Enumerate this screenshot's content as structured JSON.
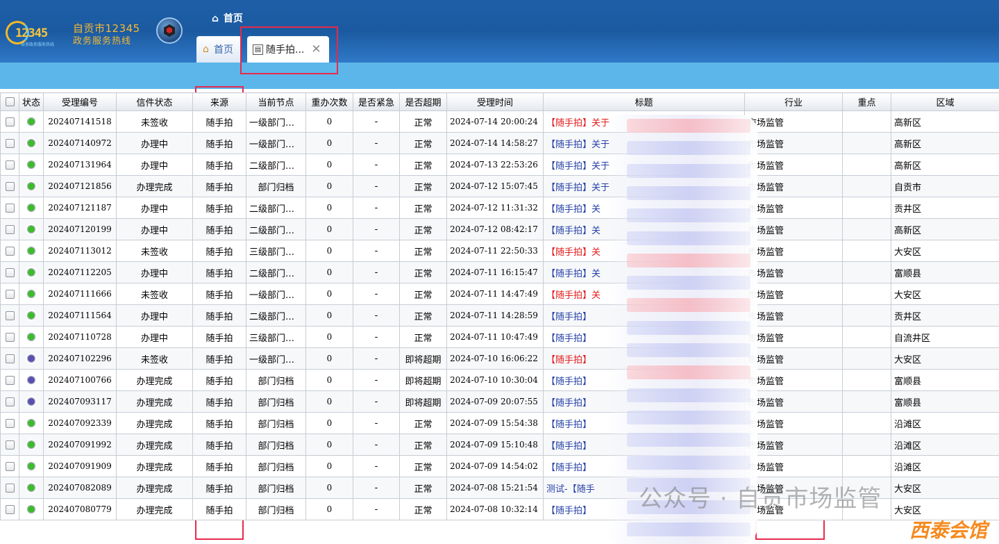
{
  "header": {
    "logo_text": "12345",
    "logo_subtext": "自贡政务服务热线",
    "brand_line1": "自贡市12345",
    "brand_line2": "政务服务热线",
    "breadcrumb": "首页"
  },
  "tabs": [
    {
      "label": "首页"
    },
    {
      "label": "随手拍..."
    }
  ],
  "columns": [
    "状态",
    "受理编号",
    "信件状态",
    "来源",
    "当前节点",
    "重办次数",
    "是否紧急",
    "是否超期",
    "受理时间",
    "标题",
    "行业",
    "重点",
    "区域"
  ],
  "rows": [
    {
      "status": "green",
      "id": "202407141518",
      "state": "未签收",
      "source": "随手拍",
      "node": "一级部门受理",
      "redo": "0",
      "urgent": "-",
      "overdue": "正常",
      "time": "2024-07-14 20:00:24",
      "title": "【随手拍】关于",
      "title_color": "red",
      "industry": "市场监管",
      "key": "",
      "area": "高新区"
    },
    {
      "status": "green",
      "id": "202407140972",
      "state": "办理中",
      "source": "随手拍",
      "node": "一级部门受理",
      "redo": "0",
      "urgent": "-",
      "overdue": "正常",
      "time": "2024-07-14 14:58:27",
      "title": "【随手拍】关于",
      "title_color": "blue",
      "industry": "市场监管",
      "key": "",
      "area": "高新区"
    },
    {
      "status": "green",
      "id": "202407131964",
      "state": "办理中",
      "source": "随手拍",
      "node": "二级部门办理",
      "redo": "0",
      "urgent": "-",
      "overdue": "正常",
      "time": "2024-07-13 22:53:26",
      "title": "【随手拍】关于",
      "title_color": "blue",
      "industry": "市场监管",
      "key": "",
      "area": "高新区"
    },
    {
      "status": "green",
      "id": "202407121856",
      "state": "办理完成",
      "source": "随手拍",
      "node": "部门归档",
      "redo": "0",
      "urgent": "-",
      "overdue": "正常",
      "time": "2024-07-12 15:07:45",
      "title": "【随手拍】关于",
      "title_color": "blue",
      "industry": "市场监管",
      "key": "",
      "area": "自贡市"
    },
    {
      "status": "green",
      "id": "202407121187",
      "state": "办理中",
      "source": "随手拍",
      "node": "二级部门办理",
      "redo": "0",
      "urgent": "-",
      "overdue": "正常",
      "time": "2024-07-12 11:31:32",
      "title": "【随手拍】关",
      "title_color": "blue",
      "industry": "市场监管",
      "key": "",
      "area": "贡井区"
    },
    {
      "status": "green",
      "id": "202407120199",
      "state": "办理中",
      "source": "随手拍",
      "node": "二级部门办理",
      "redo": "0",
      "urgent": "-",
      "overdue": "正常",
      "time": "2024-07-12 08:42:17",
      "title": "【随手拍】关",
      "title_color": "blue",
      "industry": "市场监管",
      "key": "",
      "area": "高新区"
    },
    {
      "status": "green",
      "id": "202407113012",
      "state": "未签收",
      "source": "随手拍",
      "node": "三级部门办理",
      "redo": "0",
      "urgent": "-",
      "overdue": "正常",
      "time": "2024-07-11 22:50:33",
      "title": "【随手拍】关",
      "title_color": "red",
      "industry": "市场监管",
      "key": "",
      "area": "大安区"
    },
    {
      "status": "green",
      "id": "202407112205",
      "state": "办理中",
      "source": "随手拍",
      "node": "二级部门办理",
      "redo": "0",
      "urgent": "-",
      "overdue": "正常",
      "time": "2024-07-11 16:15:47",
      "title": "【随手拍】关",
      "title_color": "blue",
      "industry": "市场监管",
      "key": "",
      "area": "富顺县"
    },
    {
      "status": "green",
      "id": "202407111666",
      "state": "未签收",
      "source": "随手拍",
      "node": "一级部门汇总",
      "redo": "0",
      "urgent": "-",
      "overdue": "正常",
      "time": "2024-07-11 14:47:49",
      "title": "【随手拍】关",
      "title_color": "red",
      "industry": "市场监管",
      "key": "",
      "area": "大安区"
    },
    {
      "status": "green",
      "id": "202407111564",
      "state": "办理中",
      "source": "随手拍",
      "node": "二级部门办理",
      "redo": "0",
      "urgent": "-",
      "overdue": "正常",
      "time": "2024-07-11 14:28:59",
      "title": "【随手拍】",
      "title_color": "blue",
      "industry": "市场监管",
      "key": "",
      "area": "贡井区"
    },
    {
      "status": "green",
      "id": "202407110728",
      "state": "办理中",
      "source": "随手拍",
      "node": "三级部门办理",
      "redo": "0",
      "urgent": "-",
      "overdue": "正常",
      "time": "2024-07-11 10:47:49",
      "title": "【随手拍】",
      "title_color": "blue",
      "industry": "市场监管",
      "key": "",
      "area": "自流井区"
    },
    {
      "status": "purple",
      "id": "202407102296",
      "state": "未签收",
      "source": "随手拍",
      "node": "一级部门汇总",
      "redo": "0",
      "urgent": "-",
      "overdue": "即将超期",
      "time": "2024-07-10 16:06:22",
      "title": "【随手拍】",
      "title_color": "red",
      "industry": "市场监管",
      "key": "",
      "area": "大安区"
    },
    {
      "status": "purple",
      "id": "202407100766",
      "state": "办理完成",
      "source": "随手拍",
      "node": "部门归档",
      "redo": "0",
      "urgent": "-",
      "overdue": "即将超期",
      "time": "2024-07-10 10:30:04",
      "title": "【随手拍】",
      "title_color": "blue",
      "industry": "市场监管",
      "key": "",
      "area": "富顺县"
    },
    {
      "status": "purple",
      "id": "202407093117",
      "state": "办理完成",
      "source": "随手拍",
      "node": "部门归档",
      "redo": "0",
      "urgent": "-",
      "overdue": "即将超期",
      "time": "2024-07-09 20:07:55",
      "title": "【随手拍】",
      "title_color": "blue",
      "industry": "市场监管",
      "key": "",
      "area": "富顺县"
    },
    {
      "status": "green",
      "id": "202407092339",
      "state": "办理完成",
      "source": "随手拍",
      "node": "部门归档",
      "redo": "0",
      "urgent": "-",
      "overdue": "正常",
      "time": "2024-07-09 15:54:38",
      "title": "【随手拍】",
      "title_color": "blue",
      "industry": "市场监管",
      "key": "",
      "area": "沿滩区"
    },
    {
      "status": "green",
      "id": "202407091992",
      "state": "办理完成",
      "source": "随手拍",
      "node": "部门归档",
      "redo": "0",
      "urgent": "-",
      "overdue": "正常",
      "time": "2024-07-09 15:10:48",
      "title": "【随手拍】",
      "title_color": "blue",
      "industry": "市场监管",
      "key": "",
      "area": "沿滩区"
    },
    {
      "status": "green",
      "id": "202407091909",
      "state": "办理完成",
      "source": "随手拍",
      "node": "部门归档",
      "redo": "0",
      "urgent": "-",
      "overdue": "正常",
      "time": "2024-07-09 14:54:02",
      "title": "【随手拍】",
      "title_color": "blue",
      "industry": "市场监管",
      "key": "",
      "area": "沿滩区"
    },
    {
      "status": "green",
      "id": "202407082089",
      "state": "办理完成",
      "source": "随手拍",
      "node": "部门归档",
      "redo": "0",
      "urgent": "-",
      "overdue": "正常",
      "time": "2024-07-08 15:21:54",
      "title": "测试-【随手",
      "title_color": "blue",
      "industry": "市场监管",
      "key": "",
      "area": "大安区"
    },
    {
      "status": "green",
      "id": "202407080779",
      "state": "办理完成",
      "source": "随手拍",
      "node": "部门归档",
      "redo": "0",
      "urgent": "-",
      "overdue": "正常",
      "time": "2024-07-08 10:32:14",
      "title": "【随手拍】",
      "title_color": "blue",
      "industry": "市场监管",
      "key": "",
      "area": "大安区"
    }
  ],
  "colors": {
    "status_green": "#3dbb2a",
    "status_purple": "#5a4fb0",
    "highlight_red": "#e8294a",
    "header_blue": "#1e5fa8",
    "strip_blue": "#5cb6ea"
  },
  "icons": {
    "home": "home-icon",
    "tab_doc": "document-search-icon",
    "close": "close-icon"
  },
  "watermark": "公众号 · 自贡市场监管",
  "watermark_corner": "西泰会馆"
}
